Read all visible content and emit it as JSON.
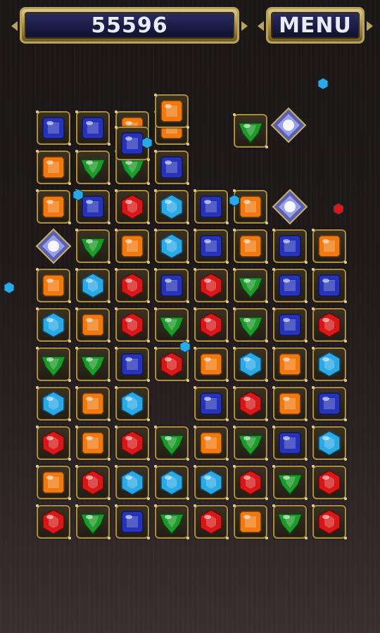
{
  "hud": {
    "score": "55596",
    "menu_label": "MENU"
  },
  "palette": {
    "blue": "#2633b8",
    "orange": "#f07a10",
    "green": "#1d9a2a",
    "cyan": "#2aa9e6",
    "red": "#d81818"
  },
  "board": {
    "columns": [
      [
        "blue",
        "orange",
        "orange",
        "special",
        "orange",
        "cyan",
        "green",
        "cyan",
        "red",
        "orange",
        "red"
      ],
      [
        "blue",
        "green",
        "blue",
        "green",
        "cyan",
        "orange",
        "green",
        "orange",
        "orange",
        "red",
        "green"
      ],
      [
        "orange",
        "green",
        "red",
        "orange",
        "red",
        "red",
        "blue",
        "cyan",
        "red",
        "cyan",
        "blue"
      ],
      [
        "orange",
        "blue",
        "cyan",
        "cyan",
        "blue",
        "green",
        "red",
        "",
        "green",
        "cyan",
        "green"
      ],
      [
        "",
        "",
        "blue",
        "blue",
        "red",
        "red",
        "orange",
        "blue",
        "orange",
        "cyan",
        "red"
      ],
      [
        "",
        "",
        "orange",
        "orange",
        "green",
        "green",
        "cyan",
        "red",
        "green",
        "red",
        "orange"
      ],
      [
        "",
        "",
        "special",
        "blue",
        "blue",
        "blue",
        "orange",
        "orange",
        "blue",
        "green",
        "green"
      ],
      [
        "",
        "",
        "",
        "orange",
        "blue",
        "red",
        "cyan",
        "blue",
        "cyan",
        "red",
        "red"
      ]
    ]
  },
  "falling_gems": {
    "col3_top": "orange",
    "col4_top": "blue",
    "col6_top": "green"
  }
}
